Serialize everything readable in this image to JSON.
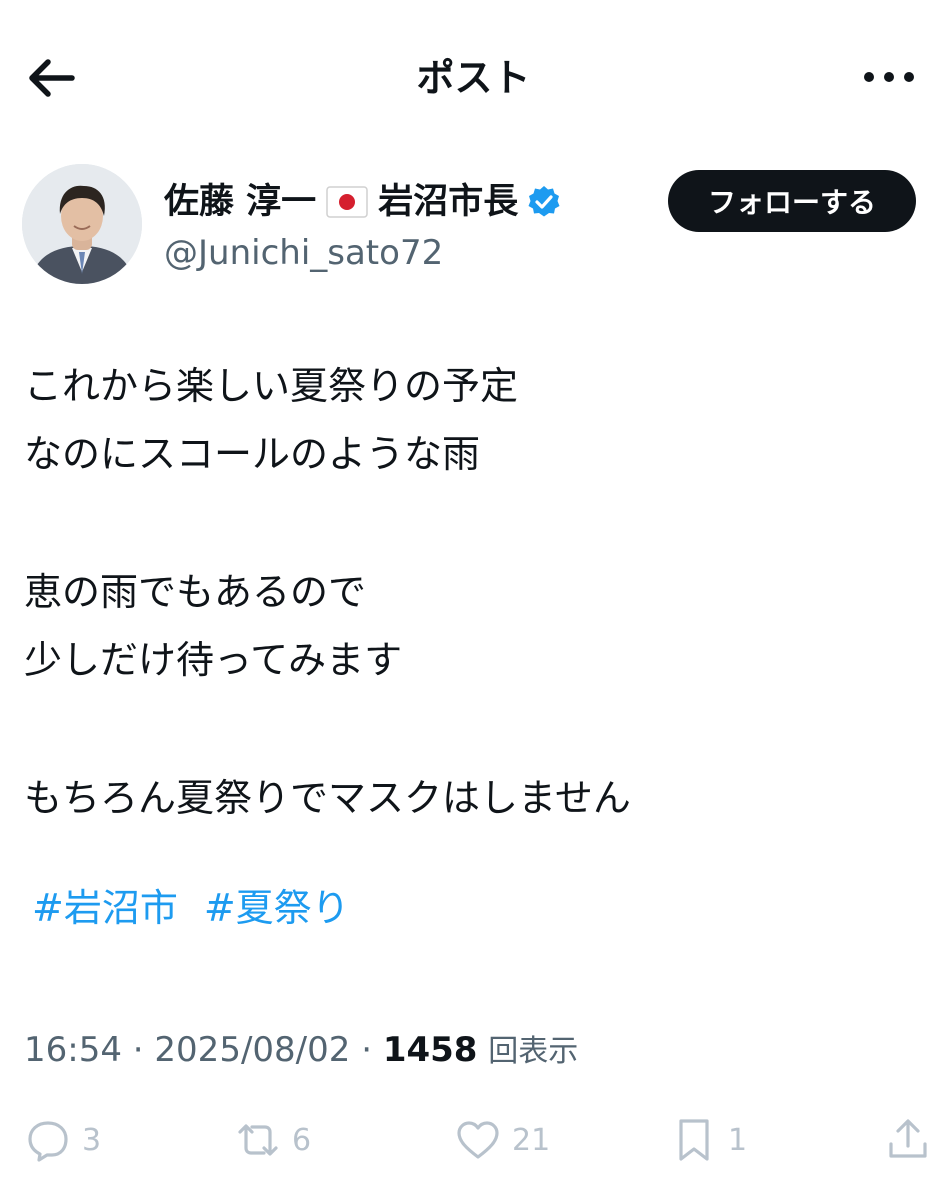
{
  "header": {
    "title": "ポスト"
  },
  "author": {
    "name": "佐藤 淳一",
    "title_suffix": "岩沼市長",
    "handle": "@Junichi_sato72",
    "follow_label": "フォローする"
  },
  "post": {
    "lines": [
      "これから楽しい夏祭りの予定",
      "なのにスコールのような雨",
      "",
      "恵の雨でもあるので",
      "少しだけ待ってみます",
      "",
      "もちろん夏祭りでマスクはしません"
    ],
    "hashtags": [
      "#岩沼市",
      "#夏祭り"
    ]
  },
  "meta": {
    "time": "16:54",
    "date": "2025/08/02",
    "views": "1458",
    "views_label": "回表示"
  },
  "actions": {
    "replies": "3",
    "reposts": "6",
    "likes": "21",
    "bookmarks": "1"
  },
  "colors": {
    "link": "#1d9bf0",
    "verified": "#1d9bf0",
    "follow_bg": "#0f1419",
    "muted": "#536471",
    "action_icon": "#b8c2cc"
  }
}
